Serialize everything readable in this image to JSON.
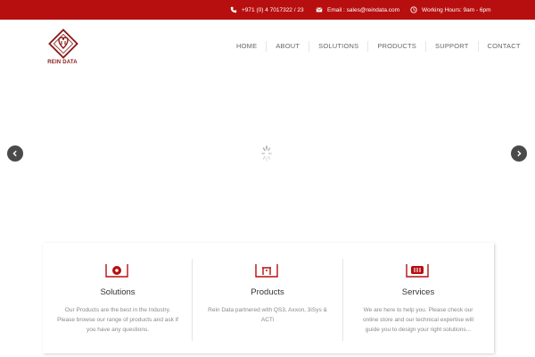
{
  "topbar": {
    "phone": "+971 (0) 4 7017322 / 23",
    "email": "Email : sales@reindata.com",
    "hours": "Working Hours: 9am - 6pm"
  },
  "logo": {
    "text": "REIN DATA"
  },
  "nav": {
    "items": [
      "HOME",
      "ABOUT",
      "SOLUTIONS",
      "PRODUCTS",
      "SUPPORT",
      "CONTACT"
    ]
  },
  "colors": {
    "brand": "#b70f0f",
    "brand_dark": "#8b1a1a",
    "arrow_bg": "#4a4a4a"
  },
  "features": [
    {
      "title": "Solutions",
      "text": "Our Products are the best in the Industry. Please browse our range of products and ask if you have any questions."
    },
    {
      "title": "Products",
      "text": "Rein Data partnered with QS3, Axxon, 3iSys & ACTi"
    },
    {
      "title": "Services",
      "text": "We are here to help you. Please check our online store and our technical expertise will guide you to design your right solutions..."
    }
  ]
}
